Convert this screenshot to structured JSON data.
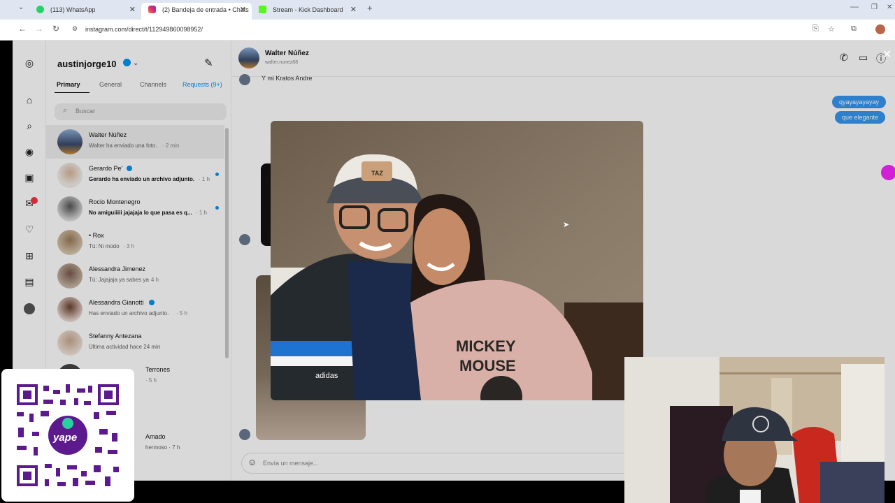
{
  "browser": {
    "tabs": [
      {
        "label": "(113) WhatsApp",
        "color": "#25d366"
      },
      {
        "label": "(2) Bandeja de entrada • Chats",
        "color": "#d6249f"
      },
      {
        "label": "Stream - Kick Dashboard",
        "color": "#53fc18"
      }
    ],
    "url": "instagram.com/direct/t/112949860098952/"
  },
  "inbox": {
    "username": "austinjorge10",
    "tabs": [
      "Primary",
      "General",
      "Channels",
      "Requests (9+)"
    ],
    "search_placeholder": "Buscar",
    "conversations": [
      {
        "name": "Walter Núñez",
        "preview": "Walter ha enviado una foto.",
        "time": "· 2 min",
        "bold": false
      },
      {
        "name": "Gerardo Pe'",
        "preview": "Gerardo ha enviado un archivo adjunto.",
        "time": "· 1 h",
        "bold": true
      },
      {
        "name": "Rocio Montenegro",
        "preview": "No amiguiiiii jajajaja lo que pasa es q...",
        "time": "· 1 h",
        "bold": true
      },
      {
        "name": "• Rox",
        "preview": "Tú: Ni modo",
        "time": "· 3 h",
        "bold": false
      },
      {
        "name": "Alessandra Jimenez",
        "preview": "Tú: Jajajaja ya sabes ya",
        "time": "· 4 h",
        "bold": false
      },
      {
        "name": "Alessandra Gianotti",
        "preview": "Has enviado un archivo adjunto.",
        "time": "· 5 h",
        "bold": false
      },
      {
        "name": "Stefanny Antezana",
        "preview": "Última actividad hace 24 min",
        "time": "",
        "bold": false
      },
      {
        "name": "Terrones",
        "preview": "",
        "time": "· 5 h",
        "bold": false
      },
      {
        "name": "Amado",
        "preview": "hermoso · 7 h",
        "time": "",
        "bold": false
      }
    ]
  },
  "chat": {
    "contact_name": "Walter Núñez",
    "contact_handle": "walter.nunez88",
    "first_message": "Y mi Kratos Andre",
    "bubbles": [
      "qyayayayayay",
      "que elegante"
    ],
    "composer_placeholder": "Envía un mensaje..."
  },
  "photo": {
    "shirt_text_1": "MICKEY",
    "shirt_text_2": "MOUSE",
    "cap_text": "TAZ",
    "brand_text": "adidas"
  },
  "qr": {
    "logo_text": "yape"
  }
}
